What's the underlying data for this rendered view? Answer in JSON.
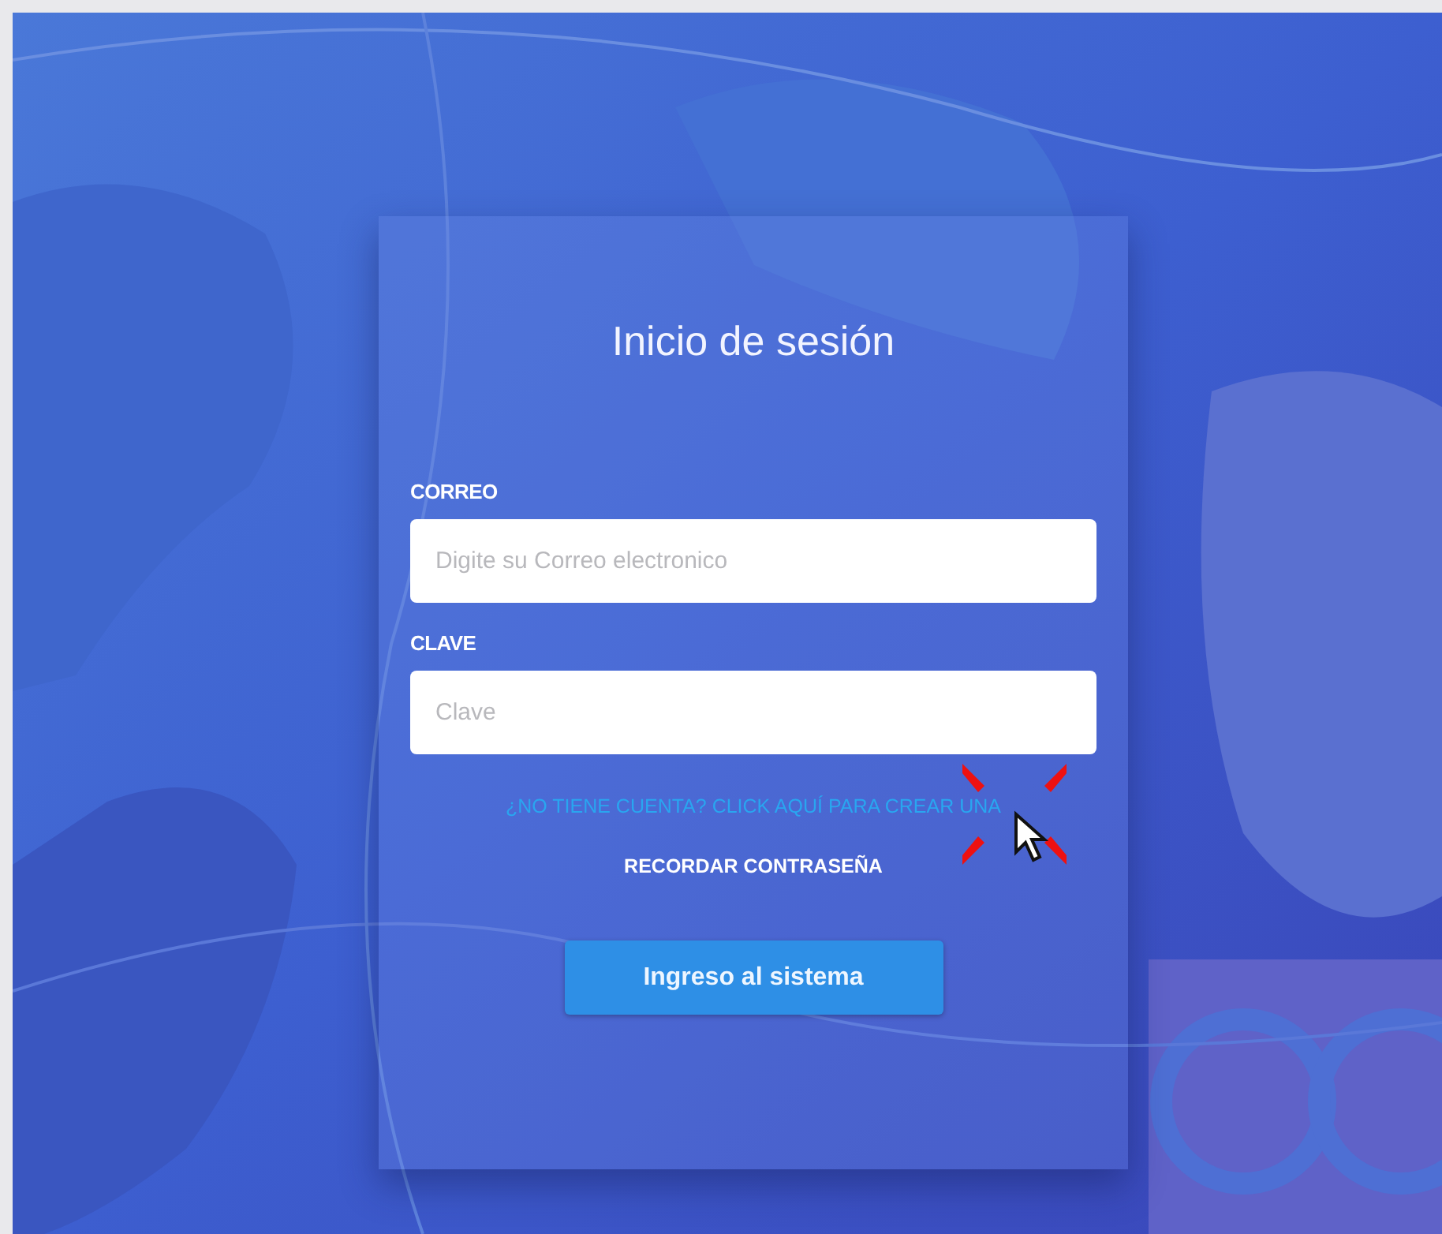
{
  "login": {
    "title": "Inicio de sesión",
    "fields": [
      {
        "label": "CORREO",
        "placeholder": "Digite su Correo electronico"
      },
      {
        "label": "CLAVE",
        "placeholder": "Clave"
      }
    ],
    "signup_link": "¿NO TIENE CUENTA? CLICK AQUÍ PARA CREAR UNA",
    "forgot_link": "RECORDAR CONTRASEÑA",
    "submit_button": "Ingreso al sistema"
  }
}
